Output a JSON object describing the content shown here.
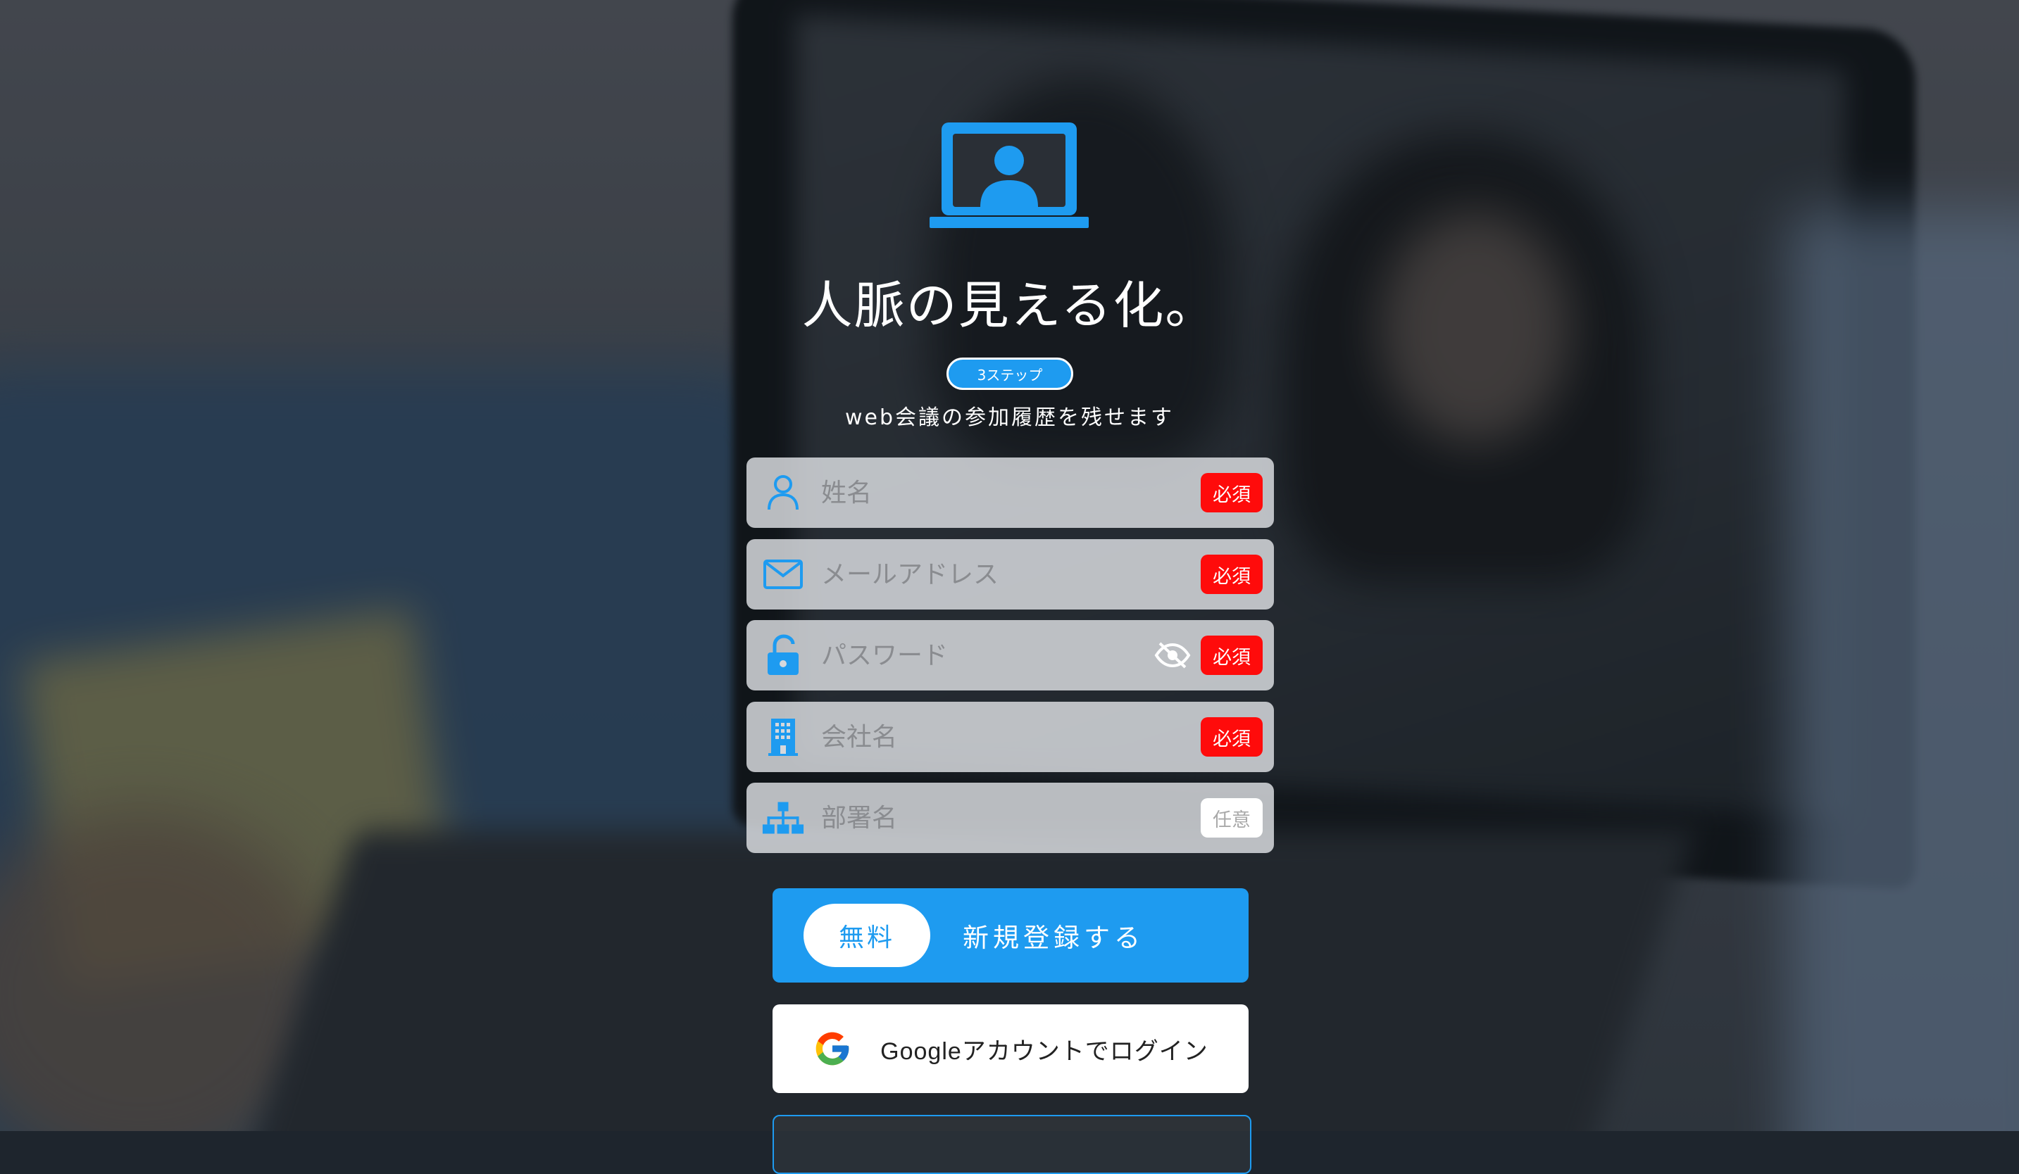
{
  "app": {
    "title": "人脈の見える化。",
    "step_badge": "3ステップ",
    "subtitle": "web会議の参加履歴を残せます"
  },
  "form": {
    "fields": [
      {
        "placeholder": "姓名",
        "icon": "person-icon",
        "tag": "必須"
      },
      {
        "placeholder": "メールアドレス",
        "icon": "mail-icon",
        "tag": "必須"
      },
      {
        "placeholder": "パスワード",
        "icon": "unlock-icon",
        "tag": "必須",
        "extra_icon": "eye-off-icon"
      },
      {
        "placeholder": "会社名",
        "icon": "building-icon",
        "tag": "必須"
      },
      {
        "placeholder": "部署名",
        "icon": "org-chart-icon",
        "tag": "任意"
      }
    ]
  },
  "actions": {
    "register_free": "無料",
    "register_label": "新規登録する",
    "google_label": "Googleアカウントでログイン"
  },
  "colors": {
    "accent": "#1E9BF0",
    "required": "#FF0B0B",
    "optional_text": "#A9A9A9"
  }
}
